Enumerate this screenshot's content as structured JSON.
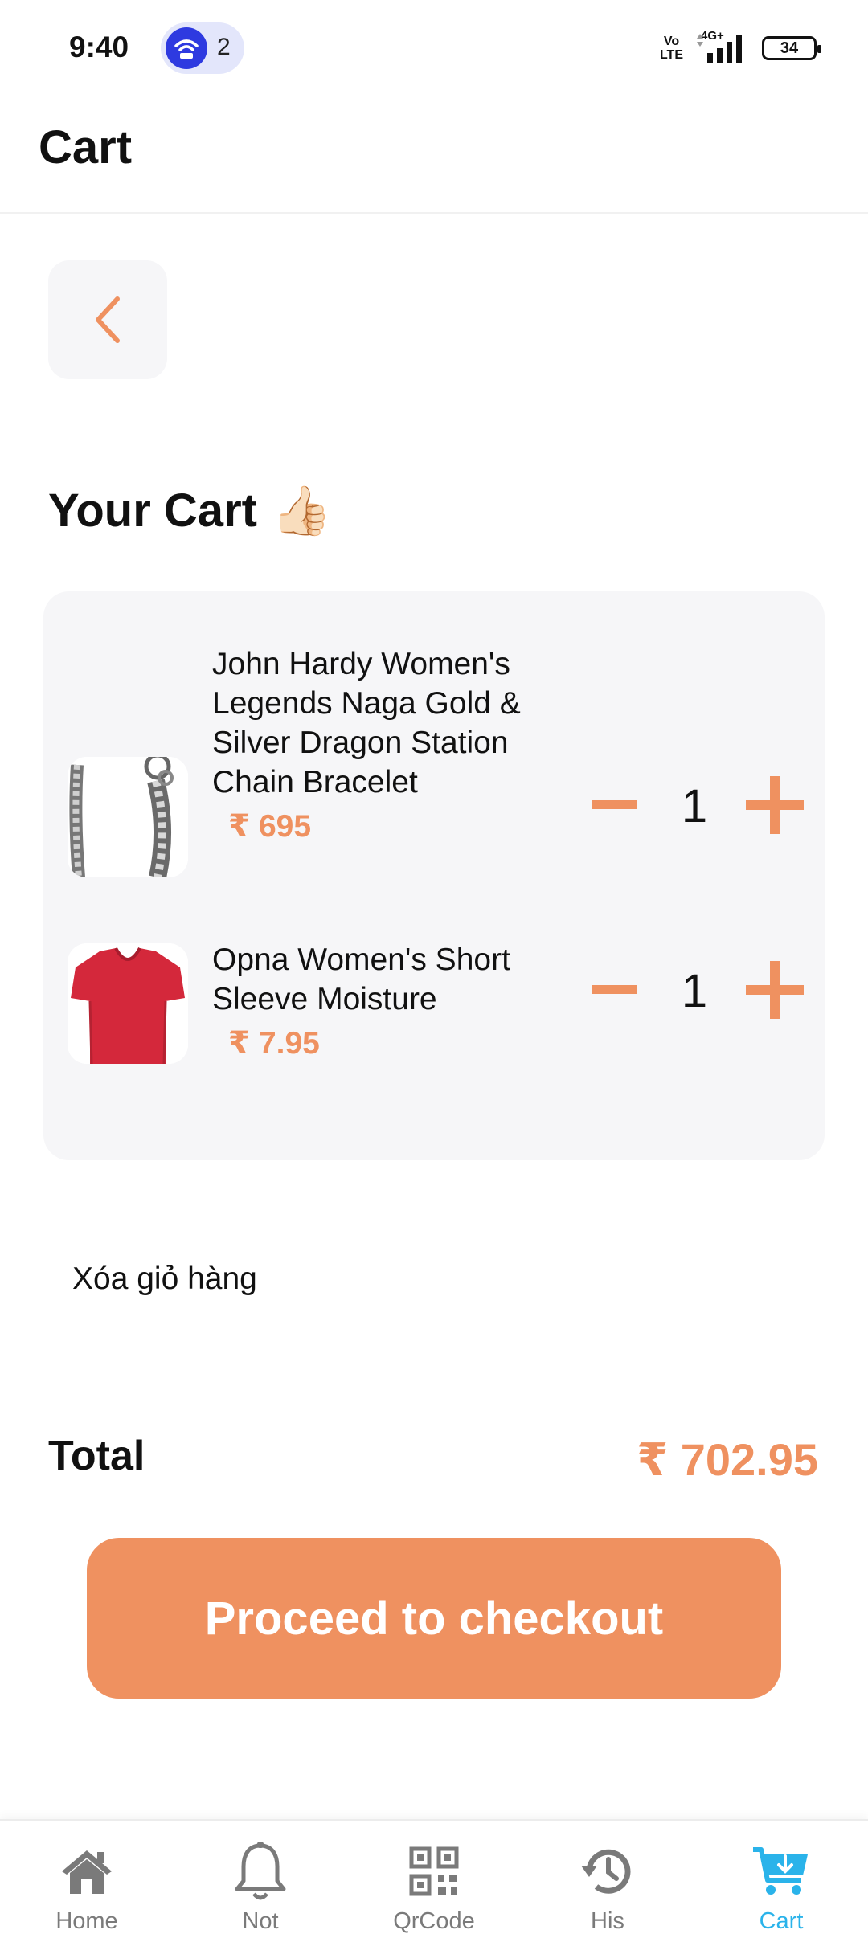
{
  "status_bar": {
    "time": "9:40",
    "hotspot_count": "2",
    "network_volte_top": "Vo",
    "network_volte_bottom": "LTE",
    "network_type": "4G+",
    "battery_level": "34"
  },
  "header": {
    "title": "Cart"
  },
  "back_button": {
    "icon": "chevron-left-icon"
  },
  "section": {
    "title": "Your Cart",
    "emoji": "👍🏻"
  },
  "cart": {
    "items": [
      {
        "name": "John Hardy Women's Legends Naga Gold & Silver Dragon Station Chain Bracelet",
        "price": "₹ 695",
        "quantity": "1",
        "image": "bracelet"
      },
      {
        "name": "Opna Women's Short Sleeve Moisture",
        "price": "₹ 7.95",
        "quantity": "1",
        "image": "red-tshirt"
      }
    ]
  },
  "clear_cart_label": "Xóa giỏ hàng",
  "total": {
    "label": "Total",
    "value": "₹ 702.95"
  },
  "checkout_label": "Proceed to checkout",
  "bottom_nav": {
    "items": [
      {
        "label": "Home",
        "icon": "home-icon"
      },
      {
        "label": "Not",
        "icon": "bell-icon"
      },
      {
        "label": "QrCode",
        "icon": "qrcode-icon"
      },
      {
        "label": "His",
        "icon": "history-icon"
      },
      {
        "label": "Cart",
        "icon": "cart-icon",
        "active": true
      }
    ]
  },
  "colors": {
    "accent": "#ef9160",
    "nav_active": "#2ab3ea",
    "panel_bg": "#f6f6f8"
  }
}
